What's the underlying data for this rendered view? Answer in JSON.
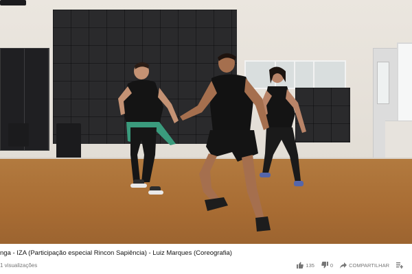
{
  "video": {
    "title": "nga - IZA (Participação especial Rincon Sapiência) - Luiz Marques (Coreografia)",
    "views": "1 visualizações"
  },
  "actions": {
    "likes": "135",
    "dislikes": "0",
    "share_label": "COMPARTILHAR"
  },
  "icons": {
    "like": "thumbs-up-icon",
    "dislike": "thumbs-down-icon",
    "share": "share-arrow-icon",
    "more": "add-to-playlist-icon"
  },
  "colors": {
    "meta_text": "#767676",
    "title_text": "#111111"
  }
}
